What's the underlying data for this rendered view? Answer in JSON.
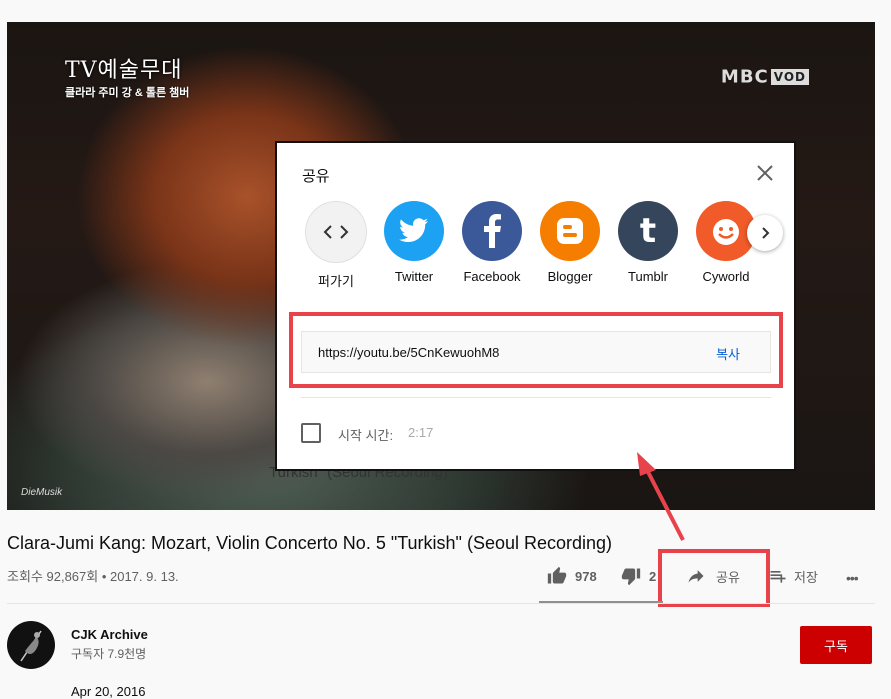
{
  "video": {
    "overlay_title": "TV예술무대",
    "overlay_subtitle": "클라라 주미 강 & 톨른 챔버",
    "broadcaster": "MBC",
    "broadcaster_badge": "VOD",
    "watermark": "DieMusik",
    "caption_fragment": "Turkish\" (Seoul Recording)"
  },
  "share_dialog": {
    "title": "공유",
    "targets": [
      {
        "label": "퍼가기",
        "icon": "embed-icon",
        "color": "#f2f2f2"
      },
      {
        "label": "Twitter",
        "icon": "twitter-icon",
        "color": "#1da1f2"
      },
      {
        "label": "Facebook",
        "icon": "facebook-icon",
        "color": "#3b5998"
      },
      {
        "label": "Blogger",
        "icon": "blogger-icon",
        "color": "#f57d00"
      },
      {
        "label": "Tumblr",
        "icon": "tumblr-icon",
        "color": "#35465c"
      },
      {
        "label": "Cyworld",
        "icon": "cyworld-icon",
        "color": "#f15a29"
      }
    ],
    "url": "https://youtu.be/5CnKewuohM8",
    "copy_label": "복사",
    "start_time_label": "시작 시간:",
    "start_time_value": "2:17"
  },
  "video_info": {
    "title": "Clara-Jumi Kang: Mozart, Violin Concerto No. 5 \"Turkish\" (Seoul Recording)",
    "meta": "조회수 92,867회 • 2017. 9. 13.",
    "likes": "978",
    "dislikes": "2",
    "share_label": "공유",
    "save_label": "저장",
    "more_label": "•••"
  },
  "channel": {
    "name": "CJK Archive",
    "subscribers": "구독자 7.9천명",
    "subscribe_label": "구독",
    "date_peek": "Apr 20, 2016"
  },
  "colors": {
    "accent_red": "#e8434b",
    "link_blue": "#065fd4",
    "subscribe_red": "#cc0000"
  }
}
